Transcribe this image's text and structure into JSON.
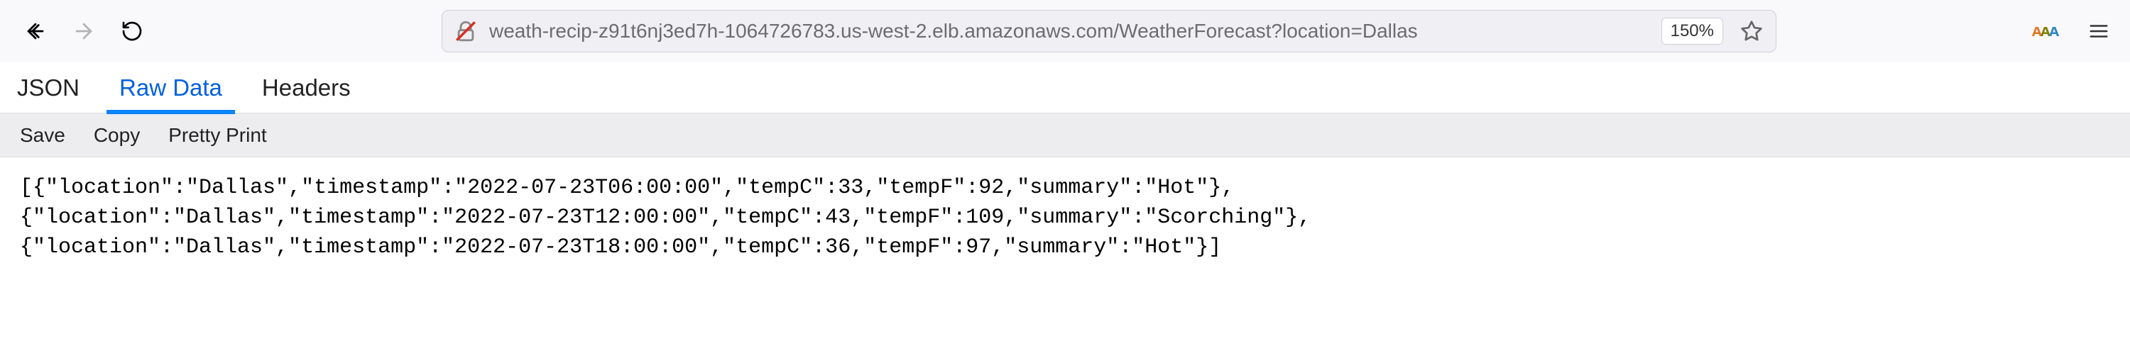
{
  "browser": {
    "url": "weath-recip-z91t6nj3ed7h-1064726783.us-west-2.elb.amazonaws.com/WeatherForecast?location=Dallas",
    "zoom": "150%"
  },
  "tabs": {
    "json": "JSON",
    "raw_data": "Raw Data",
    "headers": "Headers"
  },
  "actions": {
    "save": "Save",
    "copy": "Copy",
    "pretty_print": "Pretty Print"
  },
  "raw": {
    "line1": "[{\"location\":\"Dallas\",\"timestamp\":\"2022-07-23T06:00:00\",\"tempC\":33,\"tempF\":92,\"summary\":\"Hot\"},",
    "line2": "{\"location\":\"Dallas\",\"timestamp\":\"2022-07-23T12:00:00\",\"tempC\":43,\"tempF\":109,\"summary\":\"Scorching\"},",
    "line3": "{\"location\":\"Dallas\",\"timestamp\":\"2022-07-23T18:00:00\",\"tempC\":36,\"tempF\":97,\"summary\":\"Hot\"}]"
  }
}
